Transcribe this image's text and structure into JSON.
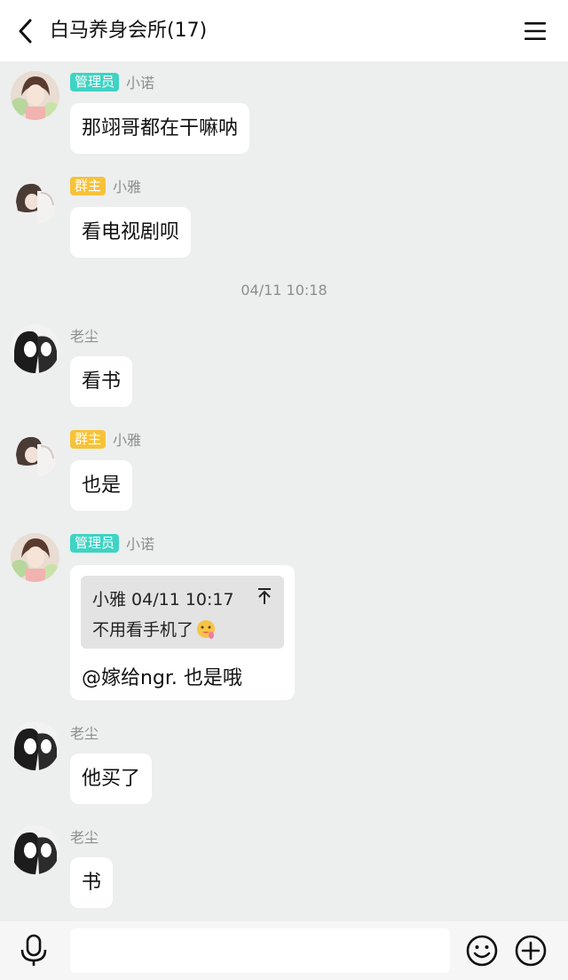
{
  "header": {
    "title": "白马养身会所(17)",
    "back_icon": "chevron-left-icon",
    "menu_icon": "hamburger-menu-icon"
  },
  "colors": {
    "admin_badge": "#3fd3c3",
    "owner_badge": "#f7c23a",
    "background": "#ecefed"
  },
  "messages": [
    {
      "badge": "管理员",
      "sender": "小诺",
      "text": "那翊哥都在干嘛呐"
    },
    {
      "badge": "群主",
      "sender": "小雅",
      "text": "看电视剧呗"
    },
    {
      "sender": "老尘",
      "text": "看书"
    },
    {
      "badge": "群主",
      "sender": "小雅",
      "text": "也是"
    },
    {
      "badge": "管理员",
      "sender": "小诺",
      "quote": {
        "header": "小雅 04/11 10:17",
        "text": "不用看手机了",
        "emoji_icon": "drooling-face-emoji"
      },
      "text": "@嫁给ngr. 也是哦"
    },
    {
      "sender": "老尘",
      "text": "他买了"
    },
    {
      "sender": "老尘",
      "text": "书"
    }
  ],
  "timestamp": "04/11 10:18",
  "input_bar": {
    "voice_icon": "microphone-icon",
    "input_value": "",
    "emoji_icon": "smiley-icon",
    "more_icon": "plus-circle-icon"
  }
}
